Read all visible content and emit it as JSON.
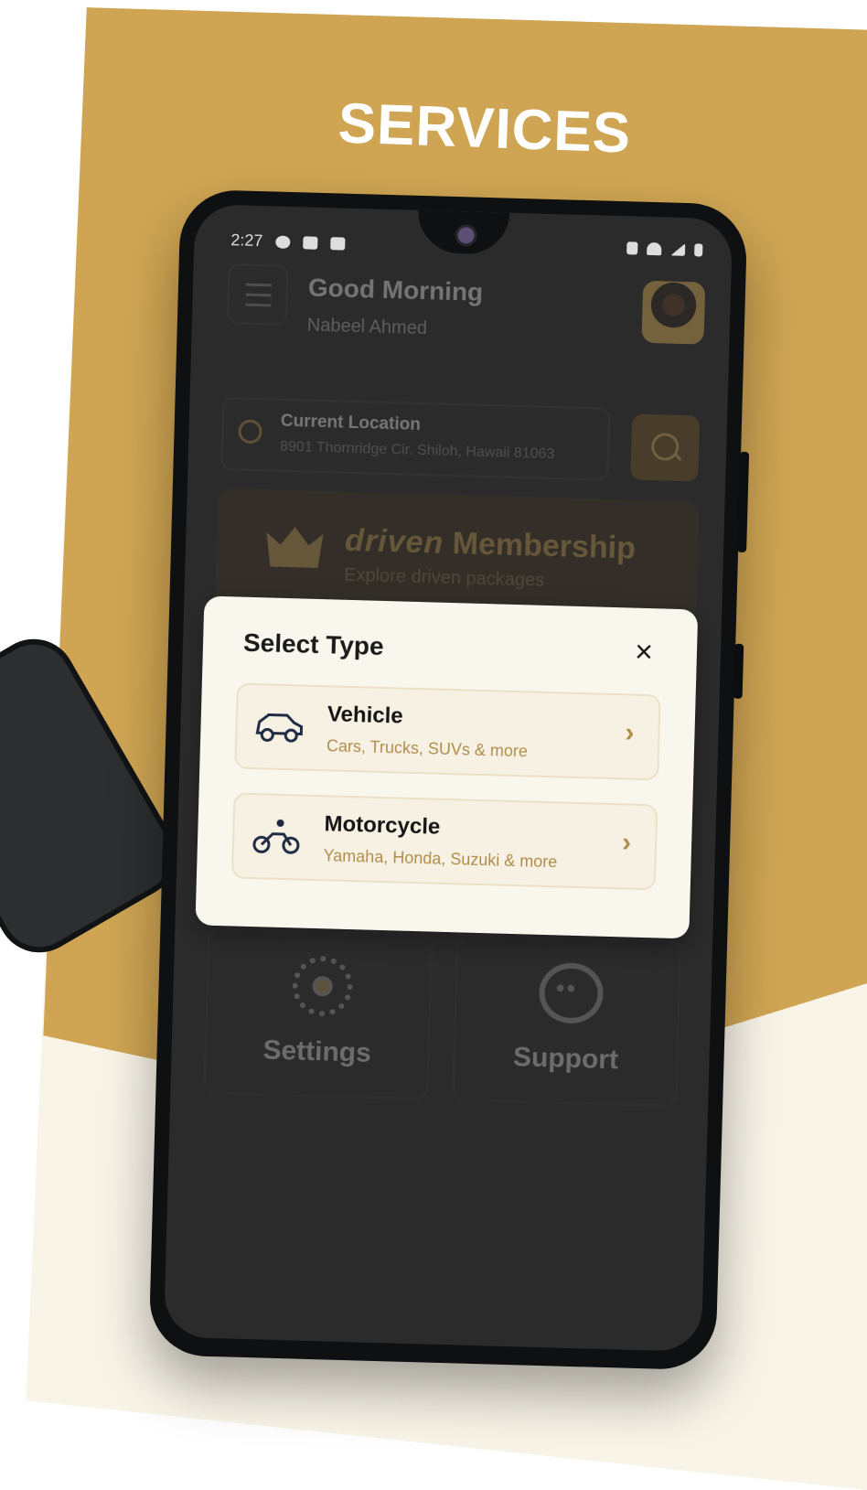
{
  "headline": "SERVICES",
  "status_bar": {
    "time": "2:27"
  },
  "greeting": {
    "title": "Good Morning",
    "name": "Nabeel Ahmed"
  },
  "location": {
    "title": "Current Location",
    "address": "8901 Thornridge Cir. Shiloh, Hawaii 81063"
  },
  "membership": {
    "brand": "driven",
    "title_suffix": "Membership",
    "subtitle": "Explore driven packages"
  },
  "tiles": [
    {
      "label": "Settings",
      "icon": "gear-icon"
    },
    {
      "label": "Support",
      "icon": "chat-bubble-icon"
    }
  ],
  "modal": {
    "title": "Select Type",
    "options": [
      {
        "title": "Vehicle",
        "subtitle": "Cars, Trucks, SUVs & more",
        "icon": "car-icon"
      },
      {
        "title": "Motorcycle",
        "subtitle": "Yamaha, Honda, Suzuki & more",
        "icon": "motorcycle-icon"
      }
    ]
  },
  "colors": {
    "gold": "#cfa553",
    "cream": "#f8f4e8",
    "modal_bg": "#f9f6ee",
    "screen_dark": "#2b2b2b"
  }
}
